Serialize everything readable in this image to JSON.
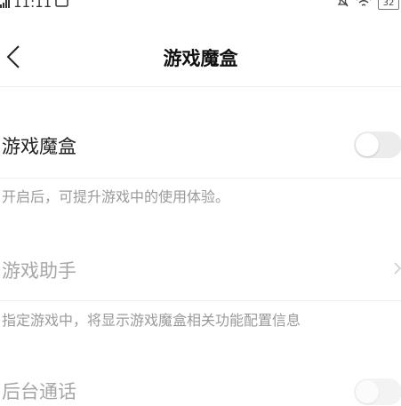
{
  "status_bar": {
    "time": "11:11",
    "battery_level": "32",
    "icons": [
      "signal-icon",
      "phone-icon",
      "bell-off-icon",
      "wifi-icon",
      "battery-icon"
    ]
  },
  "header": {
    "title": "游戏魔盒",
    "back_icon": "chevron-left-icon"
  },
  "settings": {
    "game_box": {
      "label": "游戏魔盒",
      "toggle_on": false,
      "description": "开启后，可提升游戏中的使用体验。"
    },
    "game_assistant": {
      "label": "游戏助手",
      "disabled": true,
      "description": "指定游戏中，将显示游戏魔盒相关功能配置信息"
    },
    "background_call": {
      "label": "后台通话",
      "toggle_on": false,
      "disabled": true
    }
  },
  "colors": {
    "primary_text": "#222222",
    "disabled_text": "#a6a6a6",
    "description_text": "#9a9a9a",
    "toggle_off": "#ececec"
  }
}
